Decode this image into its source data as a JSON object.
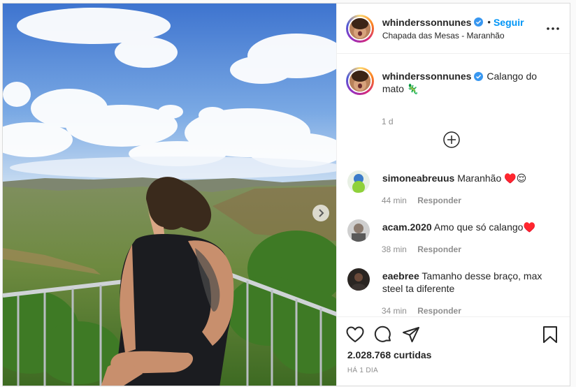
{
  "post": {
    "username": "whinderssonnunes",
    "follow_label": "Seguir",
    "separator": "•",
    "location": "Chapada das Mesas - Maranhão",
    "caption_text": "Calango do mato 🦎",
    "caption_time": "1 d",
    "likes": "2.028.768 curtidas",
    "posted_ago": "HÁ 1 DIA"
  },
  "comments": [
    {
      "user": "simoneabreuus",
      "text": "Maranhão ♥️😌",
      "time": "44 min",
      "reply": "Responder"
    },
    {
      "user": "acam.2020",
      "text": "Amo que só calango♥️",
      "time": "38 min",
      "reply": "Responder"
    },
    {
      "user": "eaebree",
      "text": "Tamanho desse braço, max steel ta diferente",
      "time": "34 min",
      "reply": "Responder"
    }
  ],
  "colors": {
    "accent": "#0095f6",
    "verified": "#3897f0",
    "muted": "#8e8e8e",
    "text": "#262626"
  },
  "icons": [
    "verified-badge-icon",
    "more-options-icon",
    "next-arrow-icon",
    "load-more-plus-icon",
    "heart-icon",
    "comment-icon",
    "share-icon",
    "bookmark-icon"
  ]
}
